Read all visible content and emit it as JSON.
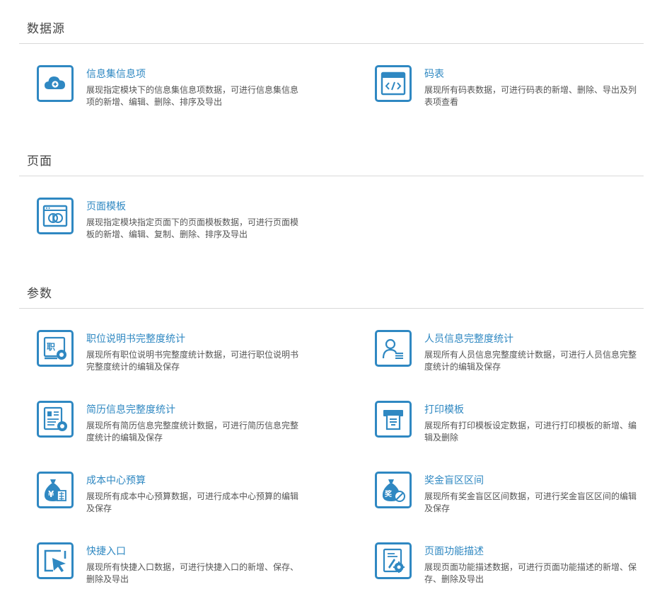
{
  "sections": [
    {
      "title": "数据源",
      "items": [
        {
          "title": "信息集信息项",
          "desc": "展现指定模块下的信息集信息项数据，可进行信息集信息项的新增、编辑、删除、排序及导出",
          "icon": "cloud-add-icon"
        },
        {
          "title": "码表",
          "desc": "展现所有码表数据，可进行码表的新增、删除、导出及列表项查看",
          "icon": "code-window-icon"
        }
      ]
    },
    {
      "title": "页面",
      "items": [
        {
          "title": "页面模板",
          "desc": "展现指定模块指定页面下的页面模板数据，可进行页面模板的新增、编辑、复制、删除、排序及导出",
          "icon": "page-template-icon"
        }
      ]
    },
    {
      "title": "参数",
      "items": [
        {
          "title": "职位说明书完整度统计",
          "desc": "展现所有职位说明书完整度统计数据，可进行职位说明书完整度统计的编辑及保存",
          "icon": "job-description-icon"
        },
        {
          "title": "人员信息完整度统计",
          "desc": "展现所有人员信息完整度统计数据，可进行人员信息完整度统计的编辑及保存",
          "icon": "person-info-icon"
        },
        {
          "title": "简历信息完整度统计",
          "desc": "展现所有简历信息完整度统计数据，可进行简历信息完整度统计的编辑及保存",
          "icon": "resume-icon"
        },
        {
          "title": "打印模板",
          "desc": "展现所有打印模板设定数据，可进行打印模板的新增、编辑及删除",
          "icon": "printer-icon"
        },
        {
          "title": "成本中心预算",
          "desc": "展现所有成本中心预算数据，可进行成本中心预算的编辑及保存",
          "icon": "budget-bag-icon"
        },
        {
          "title": "奖金盲区区间",
          "desc": "展现所有奖金盲区区间数据，可进行奖金盲区区间的编辑及保存",
          "icon": "bonus-bag-icon"
        },
        {
          "title": "快捷入口",
          "desc": "展现所有快捷入口数据，可进行快捷入口的新增、保存、删除及导出",
          "icon": "shortcut-cursor-icon"
        },
        {
          "title": "页面功能描述",
          "desc": "展现页面功能描述数据，可进行页面功能描述的新增、保存、删除及导出",
          "icon": "page-function-icon"
        }
      ]
    }
  ],
  "colors": {
    "accent": "#2f88c2",
    "rule": "#d9d9d9",
    "title_text": "#444444",
    "desc_text": "#555555"
  }
}
